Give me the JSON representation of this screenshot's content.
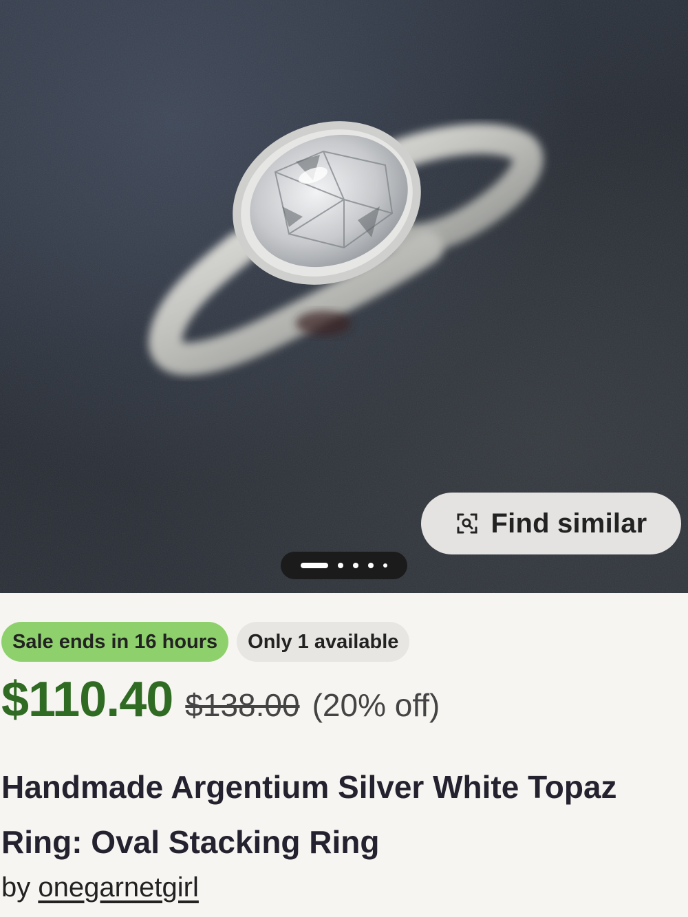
{
  "product_image": {
    "find_similar_label": "Find similar",
    "find_similar_icon": "visual-search-icon",
    "gallery_pages": 5,
    "gallery_current_page": 1
  },
  "badges": {
    "sale": "Sale ends in 16 hours",
    "availability": "Only 1 available",
    "sale_color": "#8ed16c"
  },
  "price": {
    "current": "$110.40",
    "original": "$138.00",
    "discount": "(20% off)",
    "current_color": "#2f6b22"
  },
  "listing": {
    "title_line1": "Handmade Argentium Silver White Topaz",
    "title_line2": "Ring: Oval Stacking Ring",
    "by_label": "by",
    "shop_name": "onegarnetgirl"
  }
}
